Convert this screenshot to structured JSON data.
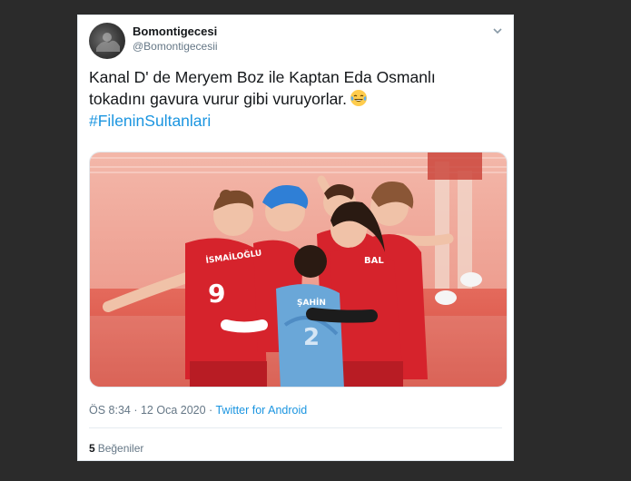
{
  "tweet": {
    "display_name": "Bomontigecesi",
    "handle": "@Bomontigecesii",
    "text_line1": "Kanal D' de Meryem Boz ile Kaptan Eda Osmanlı",
    "text_line2": "tokadını gavura vurur gibi vuruyorlar.",
    "emoji": "face-with-tears-of-joy",
    "hashtag": "#FileninSultanlari",
    "time": "ÖS 8:34",
    "separator": " · ",
    "date": "12 Oca 2020",
    "source": "Twitter for Android",
    "likes_count": "5",
    "likes_label": "Beğeniler"
  },
  "media": {
    "jersey_numbers": [
      "9",
      "2"
    ],
    "jersey_names": [
      "İSMAİLOĞLU",
      "BAL",
      "ŞAHİN"
    ]
  },
  "colors": {
    "link": "#1b95e0",
    "jersey_red": "#d6232c",
    "libero_blue": "#6aa7d8",
    "court_floor": "#e0584a"
  }
}
